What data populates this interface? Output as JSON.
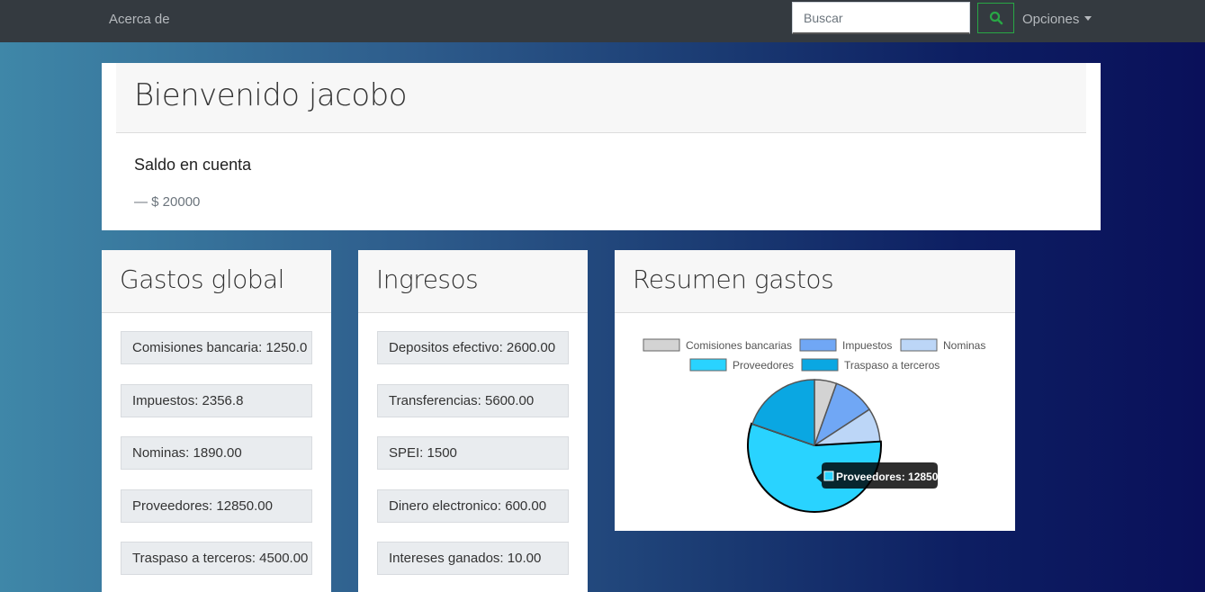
{
  "navbar": {
    "about_label": "Acerca de",
    "search_placeholder": "Buscar",
    "options_label": "Opciones"
  },
  "welcome": {
    "title": "Bienvenido jacobo",
    "balance_label": "Saldo en cuenta",
    "balance_value": "— $ 20000"
  },
  "expenses": {
    "title": "Gastos global",
    "items": [
      "Comisiones bancaria: 1250.0",
      "Impuestos: 2356.8",
      "Nominas: 1890.00",
      "Proveedores: 12850.00",
      "Traspaso a terceros: 4500.00"
    ]
  },
  "income": {
    "title": "Ingresos",
    "items": [
      "Depositos efectivo: 2600.00",
      "Transferencias: 5600.00",
      "SPEI: 1500",
      "Dinero electronico: 600.00",
      "Intereses ganados: 10.00"
    ]
  },
  "summary": {
    "title": "Resumen gastos",
    "tooltip": "Proveedores: 12850"
  },
  "chart_data": {
    "type": "pie",
    "categories": [
      "Comisiones bancarias",
      "Impuestos",
      "Nominas",
      "Proveedores",
      "Traspaso a terceros"
    ],
    "values": [
      1250.0,
      2356.8,
      1890.0,
      12850.0,
      4500.0
    ],
    "colors": [
      "#d3d3d3",
      "#70a7f5",
      "#bcd6f7",
      "#29d3ff",
      "#0aa7e2"
    ],
    "highlighted": "Proveedores",
    "legend_position": "top"
  },
  "colors": {
    "navbar_bg": "#343a40",
    "search_button_border": "#28a745",
    "search_icon": "#28a745"
  }
}
